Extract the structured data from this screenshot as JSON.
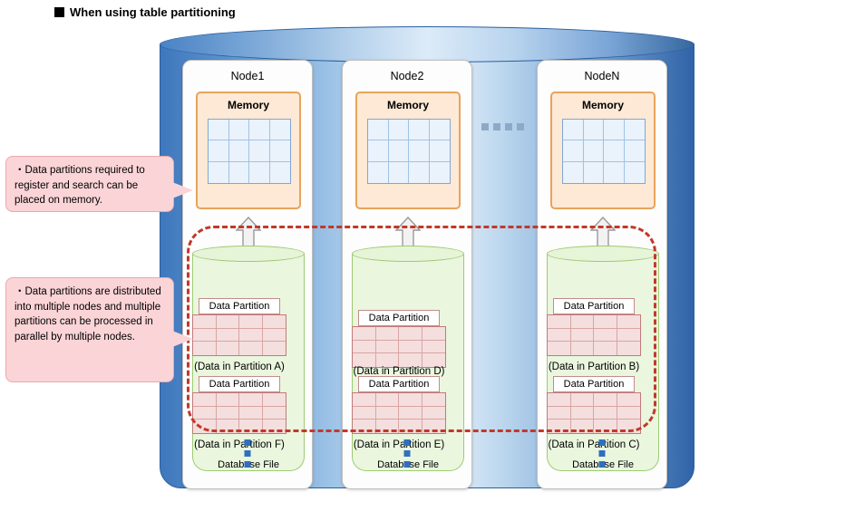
{
  "title": {
    "bullet_icon": "black-square-bullet",
    "text": "When using table partitioning"
  },
  "nodes": [
    {
      "name": "Node1",
      "memory_label": "Memory",
      "db_label": "Database File",
      "partitions": [
        {
          "label": "Data Partition",
          "caption": "(Data in Partition A)"
        },
        {
          "label": "Data Partition",
          "caption": "(Data in Partition F)"
        }
      ]
    },
    {
      "name": "Node2",
      "memory_label": "Memory",
      "db_label": "Database File",
      "partitions": [
        {
          "label": "Data Partition",
          "caption": "(Data in Partition D)"
        },
        {
          "label": "Data Partition",
          "caption": "(Data in Partition E)"
        }
      ]
    },
    {
      "name": "NodeN",
      "memory_label": "Memory",
      "db_label": "Database File",
      "partitions": [
        {
          "label": "Data Partition",
          "caption": "(Data in Partition B)"
        },
        {
          "label": "Data Partition",
          "caption": "(Data in Partition C)"
        }
      ]
    }
  ],
  "callouts": [
    {
      "text": "・Data partitions required to register and search can be placed on memory."
    },
    {
      "text": "・Data partitions are distributed into multiple nodes and multiple partitions can be processed in parallel by multiple nodes."
    }
  ],
  "colors": {
    "cluster_blue": "#3f77bd",
    "memory_orange": "#e8a35c",
    "memory_fill": "#fde9d5",
    "db_green": "#9ecb73",
    "db_fill": "#eaf6de",
    "partition_red": "#c07b7b",
    "partition_fill": "#f5dede",
    "dashed_red": "#c0392b",
    "callout_pink": "#fbd4d7",
    "dots_blue": "#2f6fc0"
  }
}
